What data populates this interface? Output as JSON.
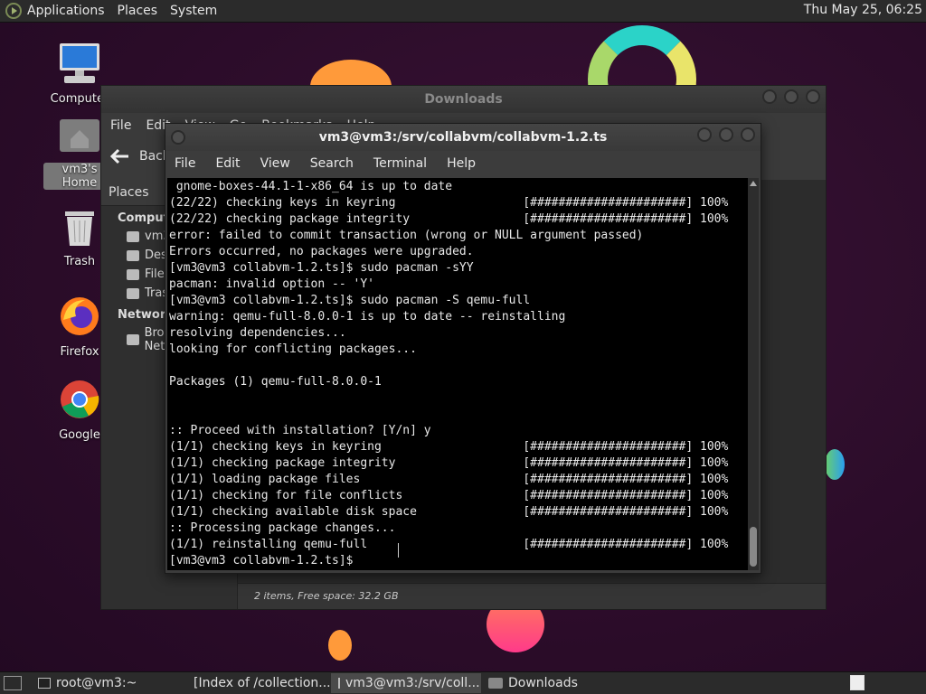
{
  "top_panel": {
    "menus": [
      "Applications",
      "Places",
      "System"
    ],
    "clock": "Thu May 25, 06:25"
  },
  "desktop_icons": [
    {
      "label": "Computer",
      "icon": "computer-icon"
    },
    {
      "label": "vm3's Home",
      "icon": "home-folder-icon"
    },
    {
      "label": "Trash",
      "icon": "trash-icon"
    },
    {
      "label": "Firefox",
      "icon": "firefox-icon"
    },
    {
      "label": "Google",
      "icon": "chrome-icon"
    }
  ],
  "file_manager": {
    "title": "Downloads",
    "menus": [
      "File",
      "Edit",
      "View",
      "Go",
      "Bookmarks",
      "Help"
    ],
    "back_label": "Back",
    "sidebar_header": "Places",
    "sections": [
      {
        "title": "Computer",
        "items": [
          "vm3",
          "Desktop",
          "File System",
          "Trash"
        ]
      },
      {
        "title": "Network",
        "items": [
          "Browse Network"
        ]
      }
    ],
    "status": "2 items, Free space: 32.2 GB"
  },
  "terminal": {
    "title": "vm3@vm3:/srv/collabvm/collabvm-1.2.ts",
    "menus": [
      "File",
      "Edit",
      "View",
      "Search",
      "Terminal",
      "Help"
    ],
    "lines": [
      " gnome-boxes-44.1-1-x86_64 is up to date",
      "(22/22) checking keys in keyring                  [######################] 100%",
      "(22/22) checking package integrity                [######################] 100%",
      "error: failed to commit transaction (wrong or NULL argument passed)",
      "Errors occurred, no packages were upgraded.",
      "[vm3@vm3 collabvm-1.2.ts]$ sudo pacman -sYY",
      "pacman: invalid option -- 'Y'",
      "[vm3@vm3 collabvm-1.2.ts]$ sudo pacman -S qemu-full",
      "warning: qemu-full-8.0.0-1 is up to date -- reinstalling",
      "resolving dependencies...",
      "looking for conflicting packages...",
      "",
      "Packages (1) qemu-full-8.0.0-1",
      "",
      "",
      ":: Proceed with installation? [Y/n] y",
      "(1/1) checking keys in keyring                    [######################] 100%",
      "(1/1) checking package integrity                  [######################] 100%",
      "(1/1) loading package files                       [######################] 100%",
      "(1/1) checking for file conflicts                 [######################] 100%",
      "(1/1) checking available disk space               [######################] 100%",
      ":: Processing package changes...",
      "(1/1) reinstalling qemu-full                      [######################] 100%",
      "[vm3@vm3 collabvm-1.2.ts]$ "
    ]
  },
  "taskbar": {
    "tasks": [
      {
        "label": "root@vm3:~",
        "icon": "terminal-icon",
        "active": false
      },
      {
        "label": "[Index of /collection...",
        "icon": "chrome-icon",
        "active": false
      },
      {
        "label": "vm3@vm3:/srv/coll...",
        "icon": "terminal-icon",
        "active": true
      },
      {
        "label": "Downloads",
        "icon": "folder-icon",
        "active": false
      }
    ]
  }
}
